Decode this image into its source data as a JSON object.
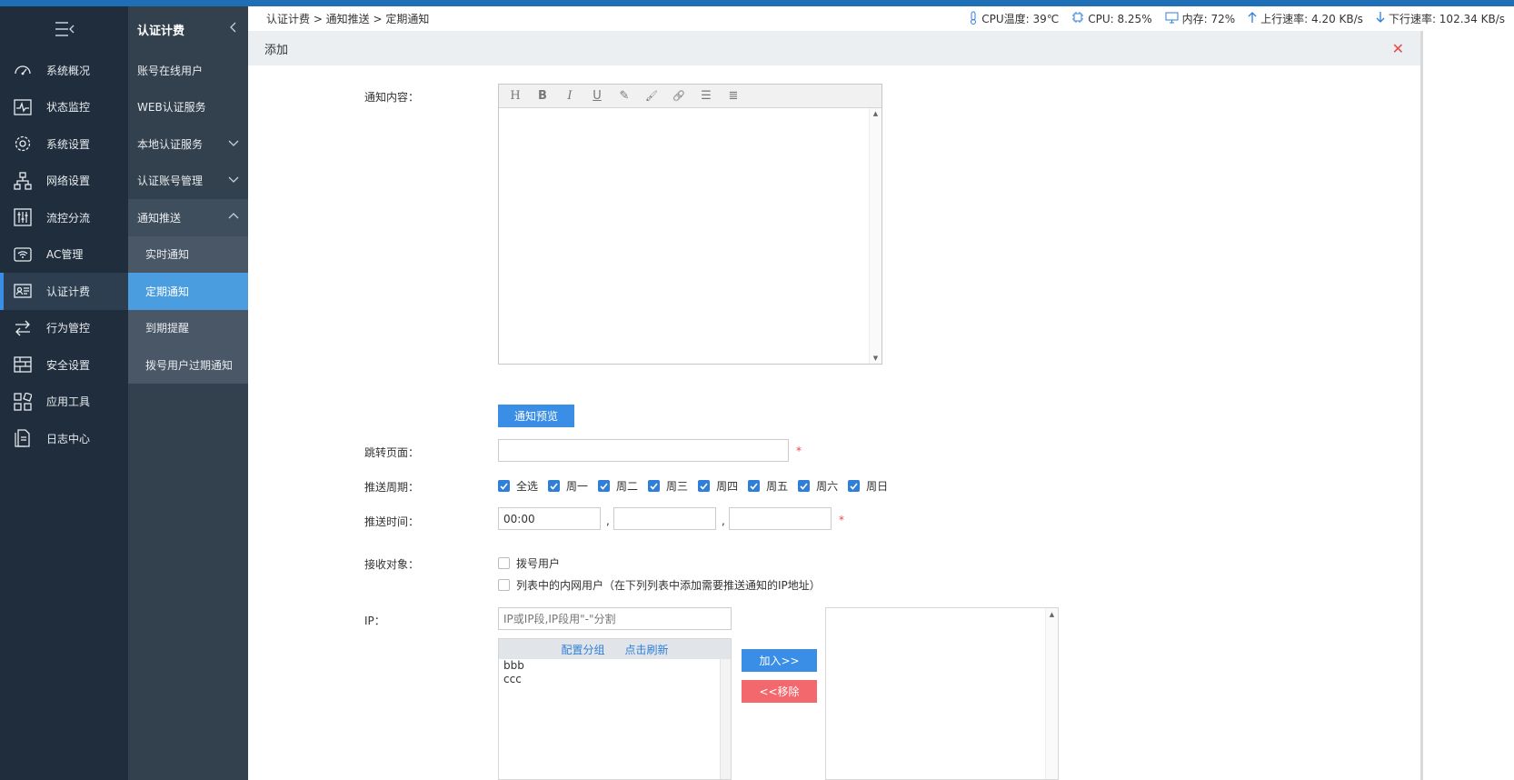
{
  "colors": {
    "accent": "#3a8ee6",
    "nav_bg": "#1f2d3d",
    "subnav_bg": "#33414e",
    "danger": "#f3686d"
  },
  "nav": {
    "items": [
      {
        "label": "系统概况",
        "icon": "dashboard-icon"
      },
      {
        "label": "状态监控",
        "icon": "pulse-monitor-icon"
      },
      {
        "label": "系统设置",
        "icon": "gear-icon"
      },
      {
        "label": "网络设置",
        "icon": "network-icon"
      },
      {
        "label": "流控分流",
        "icon": "sliders-icon"
      },
      {
        "label": "AC管理",
        "icon": "wifi-router-icon"
      },
      {
        "label": "认证计费",
        "icon": "id-card-icon"
      },
      {
        "label": "行为管控",
        "icon": "swap-arrows-icon"
      },
      {
        "label": "安全设置",
        "icon": "firewall-icon"
      },
      {
        "label": "应用工具",
        "icon": "apps-icon"
      },
      {
        "label": "日志中心",
        "icon": "document-icon"
      }
    ]
  },
  "subnav": {
    "title": "认证计费",
    "items": [
      {
        "label": "账号在线用户"
      },
      {
        "label": "WEB认证服务"
      },
      {
        "label": "本地认证服务"
      },
      {
        "label": "认证账号管理"
      },
      {
        "label": "通知推送"
      }
    ],
    "children": [
      {
        "label": "实时通知"
      },
      {
        "label": "定期通知"
      },
      {
        "label": "到期提醒"
      },
      {
        "label": "拨号用户过期通知"
      }
    ]
  },
  "breadcrumb": "认证计费 > 通知推送 > 定期通知",
  "stats": {
    "cpu_temp": "CPU温度: 39℃",
    "cpu": "CPU: 8.25%",
    "mem": "内存: 72%",
    "up": "上行速率: 4.20 KB/s",
    "down": "下行速率: 102.34 KB/s"
  },
  "panel": {
    "title": "添加"
  },
  "form": {
    "content_label": "通知内容：",
    "editor_tools": [
      "H",
      "B",
      "I",
      "U",
      "✎",
      "🖌",
      "🔗",
      "☰",
      "≣"
    ],
    "preview_button": "通知预览",
    "redirect_label": "跳转页面：",
    "redirect_value": "",
    "required_mark": "*",
    "cycle_label": "推送周期：",
    "days": [
      "全选",
      "周一",
      "周二",
      "周三",
      "周四",
      "周五",
      "周六",
      "周日"
    ],
    "time_label": "推送时间：",
    "time_values": [
      "00:00",
      "",
      ""
    ],
    "comma": ",",
    "recv_label": "接收对象：",
    "recv_options": [
      "拨号用户",
      "列表中的内网用户（在下列列表中添加需要推送通知的IP地址）"
    ],
    "ip_label": "IP：",
    "ip_placeholder": "IP或IP段,IP段用\"-\"分割",
    "list_header": [
      "配置分组",
      "点击刷新"
    ],
    "list_items": [
      "bbb",
      "ccc"
    ],
    "add_button": "加入>>",
    "remove_button": "<<移除"
  }
}
